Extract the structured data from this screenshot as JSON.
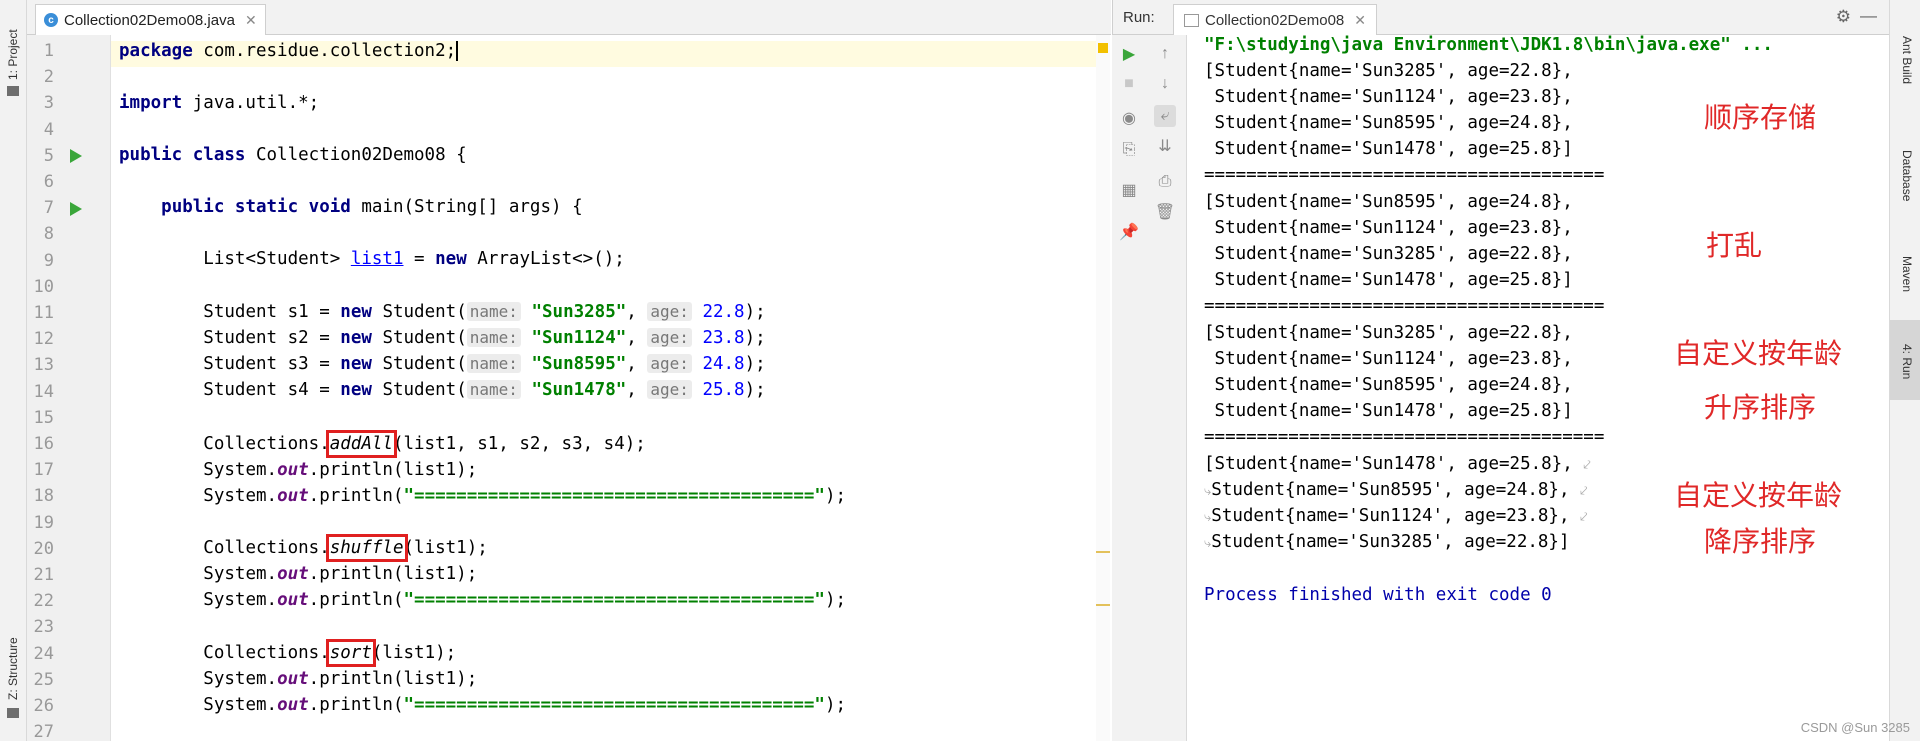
{
  "left_strip": {
    "project_label": "1: Project",
    "structure_label": "Z: Structure"
  },
  "editor": {
    "tab_label": "Collection02Demo08.java",
    "lines": [
      {
        "n": "1",
        "parts": [
          [
            "kw",
            "package"
          ],
          [
            "",
            "com.residue.collection2;"
          ]
        ]
      },
      {
        "n": "2",
        "parts": []
      },
      {
        "n": "3",
        "parts": [
          [
            "kw",
            "import"
          ],
          [
            "",
            "java.util.*;"
          ]
        ]
      },
      {
        "n": "4",
        "parts": []
      },
      {
        "n": "5",
        "parts": [
          [
            "kw",
            "public class"
          ],
          [
            "",
            "Collection02Demo08 {"
          ]
        ]
      },
      {
        "n": "6",
        "parts": []
      },
      {
        "n": "7",
        "parts": [
          [
            "kw",
            "public static void"
          ],
          [
            "",
            "main(String[] args) {"
          ]
        ]
      },
      {
        "n": "8",
        "parts": []
      },
      {
        "n": "9",
        "parts": []
      },
      {
        "n": "10",
        "parts": []
      },
      {
        "n": "11",
        "parts": []
      },
      {
        "n": "12",
        "parts": []
      },
      {
        "n": "13",
        "parts": []
      },
      {
        "n": "14",
        "parts": []
      },
      {
        "n": "15",
        "parts": []
      },
      {
        "n": "16",
        "parts": []
      },
      {
        "n": "17",
        "parts": []
      },
      {
        "n": "18",
        "parts": []
      },
      {
        "n": "19",
        "parts": []
      },
      {
        "n": "20",
        "parts": []
      },
      {
        "n": "21",
        "parts": []
      },
      {
        "n": "22",
        "parts": []
      },
      {
        "n": "23",
        "parts": []
      },
      {
        "n": "24",
        "parts": []
      },
      {
        "n": "25",
        "parts": []
      },
      {
        "n": "26",
        "parts": []
      },
      {
        "n": "27",
        "parts": []
      }
    ],
    "code": {
      "l9_type": "List<Student>",
      "l9_var": "list1",
      "l9_eq": "=",
      "l9_new": "new",
      "l9_rest": "ArrayList<>();",
      "student_decl": "Student",
      "new_kw": "new",
      "ctor": "Student(",
      "hint_name": "name:",
      "hint_age": "age:",
      "s_vars": [
        "s1",
        "s2",
        "s3",
        "s4"
      ],
      "s_names": [
        "\"Sun3285\"",
        "\"Sun1124\"",
        "\"Sun8595\"",
        "\"Sun1478\""
      ],
      "s_ages": [
        "22.8",
        "23.8",
        "24.8",
        "25.8"
      ],
      "collections": "Collections.",
      "addAll": "addAll",
      "addAll_args": "(list1, s1, s2, s3, s4);",
      "shuffle": "shuffle",
      "sort": "sort",
      "list_arg": "(list1);",
      "system": "System.",
      "out": "out",
      "println_list": ".println(list1);",
      "println_open": ".println(",
      "sep_string": "\"======================================\"",
      "println_close": ");"
    }
  },
  "run": {
    "label": "Run:",
    "tab_label": "Collection02Demo08",
    "command_line": "\"F:\\studying\\java Environment\\JDK1.8\\bin\\java.exe\" ...",
    "blocks": [
      [
        "[Student{name='Sun3285', age=22.8},",
        " Student{name='Sun1124', age=23.8},",
        " Student{name='Sun8595', age=24.8},",
        " Student{name='Sun1478', age=25.8}]"
      ],
      [
        "[Student{name='Sun8595', age=24.8},",
        " Student{name='Sun1124', age=23.8},",
        " Student{name='Sun3285', age=22.8},",
        " Student{name='Sun1478', age=25.8}]"
      ],
      [
        "[Student{name='Sun3285', age=22.8},",
        " Student{name='Sun1124', age=23.8},",
        " Student{name='Sun8595', age=24.8},",
        " Student{name='Sun1478', age=25.8}]"
      ],
      [
        "[Student{name='Sun1478', age=25.8},",
        "Student{name='Sun8595', age=24.8},",
        "Student{name='Sun1124', age=23.8},",
        "Student{name='Sun3285', age=22.8}]"
      ]
    ],
    "separator": "======================================",
    "finish": "Process finished with exit code 0",
    "annotations": {
      "a1": "顺序存储",
      "a2": "打乱",
      "a3a": "自定义按年龄",
      "a3b": "升序排序",
      "a4a": "自定义按年龄",
      "a4b": "降序排序"
    }
  },
  "right_strip": {
    "ant": "Ant Build",
    "db": "Database",
    "maven": "Maven",
    "run": "4: Run"
  },
  "watermark": "CSDN @Sun 3285",
  "colors": {
    "keyword": "#000080",
    "string": "#008000",
    "number": "#0000ff",
    "field": "#660e7a",
    "annotation": "#e02828",
    "highlight_box": "#e02020"
  }
}
